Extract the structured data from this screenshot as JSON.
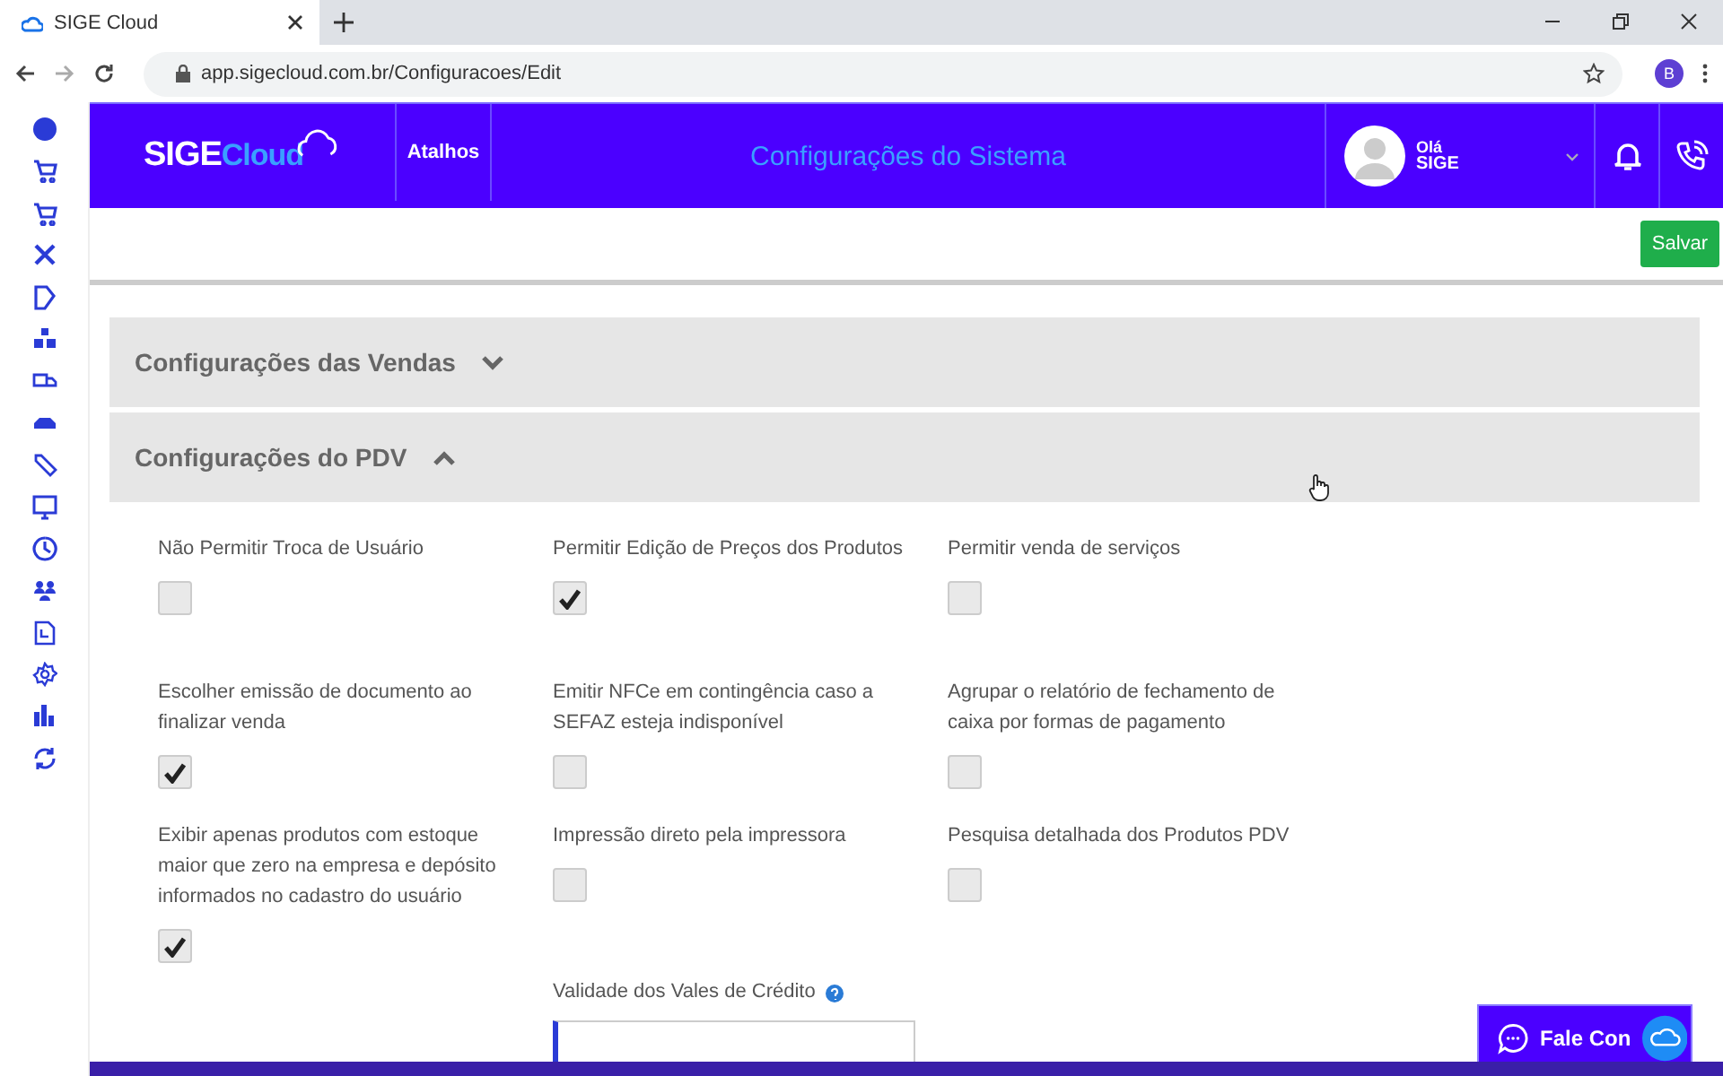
{
  "browser": {
    "tab_title": "SIGE Cloud",
    "url": "app.sigecloud.com.br/Configuracoes/Edit",
    "profile_initial": "B"
  },
  "header": {
    "logo": {
      "part1": "SIGE",
      "part2": "Cloud"
    },
    "shortcuts": "Atalhos",
    "title": "Configurações do Sistema",
    "greeting": "Olá",
    "user_name": "SIGE"
  },
  "toolbar": {
    "save": "Salvar"
  },
  "sections": [
    {
      "title": "Configurações das Vendas",
      "expanded": false
    },
    {
      "title": "Configurações do PDV",
      "expanded": true
    }
  ],
  "settings": [
    {
      "kind": "checkbox",
      "label": "Não Permitir Troca de Usuário",
      "checked": false
    },
    {
      "kind": "checkbox",
      "label": "Permitir Edição de Preços dos Produtos",
      "checked": true
    },
    {
      "kind": "checkbox",
      "label": "Permitir venda de serviços",
      "checked": false
    },
    {
      "kind": "checkbox",
      "label": "Escolher emissão de documento ao finalizar venda",
      "checked": true
    },
    {
      "kind": "checkbox",
      "label": "Emitir NFCe em contingência caso a SEFAZ esteja indisponível",
      "checked": false
    },
    {
      "kind": "checkbox",
      "label": "Agrupar o relatório de fechamento de caixa por formas de pagamento",
      "checked": false
    },
    {
      "kind": "checkbox",
      "label": "Exibir apenas produtos com estoque maior que zero na empresa e depósito informados no cadastro do usuário",
      "checked": true
    },
    {
      "kind": "checkbox",
      "label": "Impressão direto pela impressora",
      "checked": false
    },
    {
      "kind": "checkbox",
      "label": "Pesquisa detalhada dos Produtos PDV",
      "checked": false
    },
    {
      "kind": "text-field",
      "label": "Validade dos Vales de Crédito",
      "focused": true
    }
  ],
  "chat": {
    "label": "Fale Con"
  }
}
